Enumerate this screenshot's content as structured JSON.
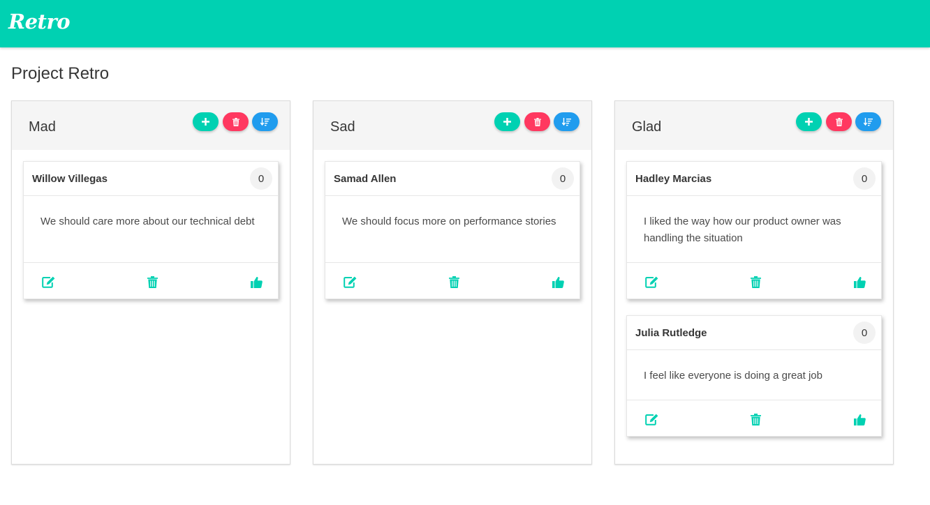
{
  "app": {
    "brand": "Retro"
  },
  "page": {
    "title": "Project Retro"
  },
  "colors": {
    "primary": "#00d1b2",
    "danger": "#ff3860",
    "info": "#209cee"
  },
  "icons": {
    "add": "plus-icon",
    "delete": "trash-icon",
    "sort": "sort-amount-down-icon",
    "edit": "edit-icon",
    "like": "thumbs-up-icon"
  },
  "columns": [
    {
      "title": "Mad",
      "cards": [
        {
          "author": "Willow Villegas",
          "votes": "0",
          "text": "We should care more about our technical debt"
        }
      ]
    },
    {
      "title": "Sad",
      "cards": [
        {
          "author": "Samad Allen",
          "votes": "0",
          "text": "We should focus more on performance stories"
        }
      ]
    },
    {
      "title": "Glad",
      "cards": [
        {
          "author": "Hadley Marcias",
          "votes": "0",
          "text": "I liked the way how our product owner was handling the situation"
        },
        {
          "author": "Julia Rutledge",
          "votes": "0",
          "text": "I feel like everyone is doing a great job"
        }
      ]
    }
  ]
}
